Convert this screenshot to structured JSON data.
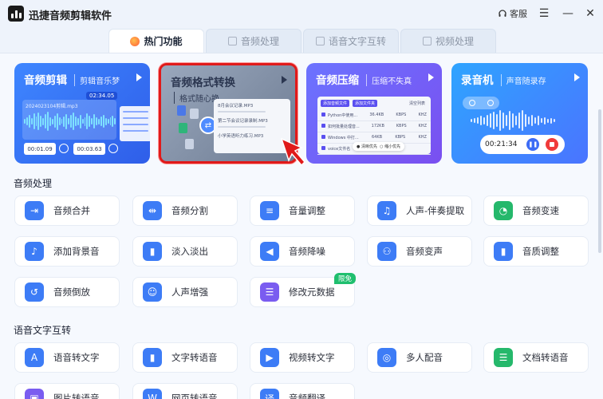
{
  "app": {
    "title": "迅捷音频剪辑软件",
    "service": "客服"
  },
  "window_controls": {
    "menu": "☰",
    "minimize": "—",
    "close": "✕"
  },
  "tabs": [
    {
      "label": "热门功能",
      "icon": "flame-icon"
    },
    {
      "label": "音频处理",
      "icon": "audio-file-icon"
    },
    {
      "label": "语音文字互转",
      "icon": "document-icon"
    },
    {
      "label": "视频处理",
      "icon": "video-icon"
    }
  ],
  "cards": [
    {
      "title": "音频剪辑",
      "subtitle": "剪辑音乐梦",
      "file": "2024023104剪辑.mp3",
      "bubble": "02:34.05",
      "start": "00:01.09",
      "end": "00:03.63"
    },
    {
      "title": "音频格式转换",
      "subtitle": "格式随心换",
      "rows": [
        "8月会议记录.MP3",
        "第二节会议记录录制.MP3",
        "小学英语听力练习.MP3"
      ]
    },
    {
      "title": "音频压缩",
      "subtitle": "压缩不失真",
      "buttons": [
        "添加音频文件",
        "添加文件夹",
        "清空列表"
      ],
      "rows": [
        {
          "name": "Python中使用...",
          "size": "36.4KB",
          "rate": "KBPS",
          "hz": "KHZ"
        },
        {
          "name": "如何批量处理音...",
          "size": "172KB",
          "rate": "KBPS",
          "hz": "KHZ"
        },
        {
          "name": "Windows 中打...",
          "size": "64KB",
          "rate": "KBPS",
          "hz": "KHZ"
        },
        {
          "name": "voice文件名",
          "size": "",
          "rate": "",
          "hz": ""
        }
      ],
      "options": [
        "清晰优先",
        "缩小优先"
      ]
    },
    {
      "title": "录音机",
      "subtitle": "声音随录存",
      "time": "00:21:34"
    }
  ],
  "sections": [
    {
      "title": "音频处理",
      "tools": [
        {
          "label": "音频合并",
          "icon": "merge-icon",
          "color": "#3d7cf6",
          "glyph": "⇥"
        },
        {
          "label": "音频分割",
          "icon": "split-icon",
          "color": "#3d7cf6",
          "glyph": "⇹"
        },
        {
          "label": "音量调整",
          "icon": "volume-sliders-icon",
          "color": "#3d7cf6",
          "glyph": "≡"
        },
        {
          "label": "人声-伴奏提取",
          "icon": "headphones-icon",
          "color": "#3d7cf6",
          "glyph": "♫"
        },
        {
          "label": "音频变速",
          "icon": "speed-icon",
          "color": "#25b86b",
          "glyph": "◔"
        },
        {
          "label": "添加背景音",
          "icon": "music-note-icon",
          "color": "#3d7cf6",
          "glyph": "♪"
        },
        {
          "label": "淡入淡出",
          "icon": "fade-bars-icon",
          "color": "#3d7cf6",
          "glyph": "▮"
        },
        {
          "label": "音频降噪",
          "icon": "speaker-icon",
          "color": "#3d7cf6",
          "glyph": "◀"
        },
        {
          "label": "音频变声",
          "icon": "voice-change-icon",
          "color": "#3d7cf6",
          "glyph": "⚇"
        },
        {
          "label": "音质调整",
          "icon": "quality-bars-icon",
          "color": "#3d7cf6",
          "glyph": "▮"
        },
        {
          "label": "音频倒放",
          "icon": "reverse-icon",
          "color": "#3d7cf6",
          "glyph": "↺"
        },
        {
          "label": "人声增强",
          "icon": "voice-enhance-icon",
          "color": "#3d7cf6",
          "glyph": "☺"
        },
        {
          "label": "修改元数据",
          "icon": "metadata-icon",
          "color": "#7a5cf0",
          "glyph": "☰",
          "badge": "限免"
        }
      ]
    },
    {
      "title": "语音文字互转",
      "tools": [
        {
          "label": "语音转文字",
          "icon": "letter-a-icon",
          "color": "#3d7cf6",
          "glyph": "A"
        },
        {
          "label": "文字转语音",
          "icon": "sound-bars-icon",
          "color": "#3d7cf6",
          "glyph": "▮"
        },
        {
          "label": "视频转文字",
          "icon": "play-circle-icon",
          "color": "#3d7cf6",
          "glyph": "▶"
        },
        {
          "label": "多人配音",
          "icon": "ear-icon",
          "color": "#3d7cf6",
          "glyph": "◎"
        },
        {
          "label": "文档转语音",
          "icon": "document-lines-icon",
          "color": "#25b86b",
          "glyph": "☰"
        },
        {
          "label": "图片转语音",
          "icon": "image-icon",
          "color": "#7a5cf0",
          "glyph": "▣"
        },
        {
          "label": "网页转语音",
          "icon": "web-icon",
          "color": "#3d7cf6",
          "glyph": "W"
        },
        {
          "label": "音频翻译",
          "icon": "translate-icon",
          "color": "#3d7cf6",
          "glyph": "译"
        }
      ]
    }
  ]
}
